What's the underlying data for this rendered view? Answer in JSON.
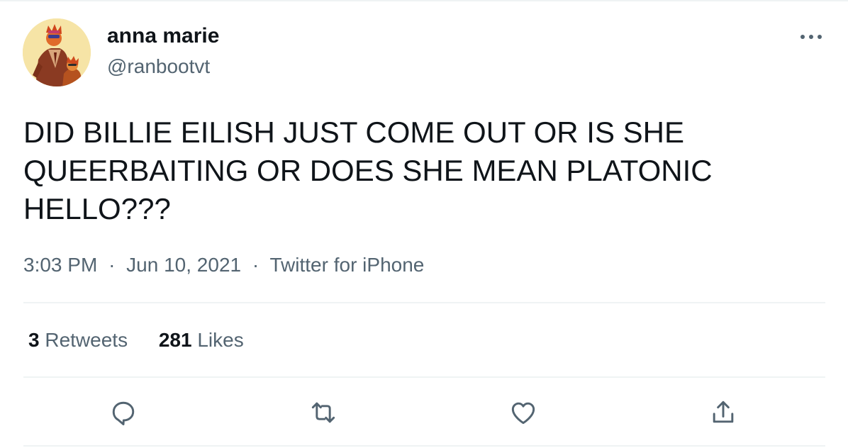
{
  "author": {
    "display_name": "anna marie",
    "handle": "@ranbootvt"
  },
  "tweet": {
    "text": "DID BILLIE EILISH JUST COME OUT OR IS SHE QUEERBAITING OR DOES SHE MEAN PLATONIC HELLO???",
    "time": "3:03 PM",
    "date": "Jun 10, 2021",
    "source": "Twitter for iPhone",
    "separator": "·"
  },
  "stats": {
    "retweets_count": "3",
    "retweets_label": "Retweets",
    "likes_count": "281",
    "likes_label": "Likes"
  },
  "actions": [
    "reply-icon",
    "retweet-icon",
    "like-icon",
    "share-icon"
  ],
  "colors": {
    "text": "#0f1419",
    "secondary": "#536471",
    "divider": "#eff3f4",
    "avatar_bg": "#f6e4a6"
  }
}
